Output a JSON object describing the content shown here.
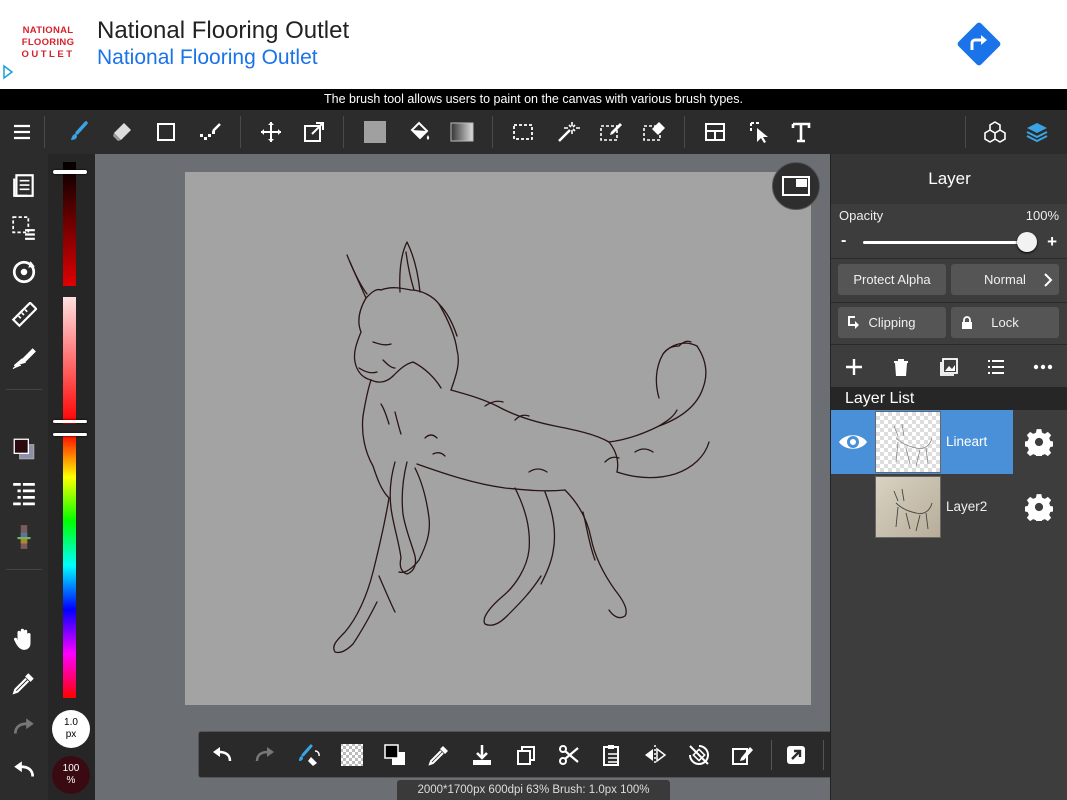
{
  "ad": {
    "logo_line1": "NATIONAL",
    "logo_line2": "FLOORING",
    "logo_line3": "OUTLET",
    "title": "National Flooring Outlet",
    "subtitle": "National Flooring Outlet",
    "icons": [
      "adchoices-icon",
      "directions-icon"
    ]
  },
  "tip": "The brush tool allows users to paint on the canvas with various brush types.",
  "toolbar": {
    "active_tool": "brush",
    "accent_color": "#3aa3e3",
    "icons": [
      "menu-icon",
      "brush-icon",
      "eraser-icon",
      "rectangle-icon",
      "dot-brush-icon",
      "move-icon",
      "transform-icon",
      "fill-color-icon",
      "bucket-icon",
      "gradient-icon",
      "select-rect-icon",
      "magic-wand-icon",
      "select-pen-icon",
      "select-eraser-icon",
      "panel-icon",
      "operation-icon",
      "text-icon",
      "material-icon",
      "layer-icon"
    ]
  },
  "lefttools": {
    "icons": [
      "pages-icon",
      "selection-layer-icon",
      "rotate-icon",
      "ruler-icon",
      "fill-tool-icon",
      "color-swatch-icon",
      "layer-list-icon",
      "palette-icon",
      "hand-icon",
      "eyedropper-icon",
      "redo-icon",
      "undo-icon"
    ]
  },
  "colors": {
    "foreground": "#2b0a10",
    "background": "#8c90a8",
    "brush_size": "1.0",
    "brush_unit": "px",
    "opacity_value": "100",
    "opacity_unit": "%"
  },
  "canvas": {
    "paper_color": "#a3a3a3",
    "stroke_color": "#2a1416"
  },
  "bottombar": {
    "icons": [
      "undo-icon",
      "redo-icon",
      "brush-eraser-toggle-icon",
      "transparent-swatch-icon",
      "color-swap-icon",
      "eyedropper-icon",
      "save-icon",
      "copy-icon",
      "cut-icon",
      "paste-icon",
      "flip-icon",
      "rotate-reset-icon",
      "transform-icon",
      "share-icon",
      "more-icon"
    ]
  },
  "status": "2000*1700px 600dpi 63% Brush: 1.0px 100%",
  "panel": {
    "title": "Layer",
    "opacity_label": "Opacity",
    "opacity_value": "100%",
    "opacity_level": 1.0,
    "minus": "-",
    "plus": "+",
    "protect_alpha": "Protect Alpha",
    "blend_mode": "Normal",
    "clipping": "Clipping",
    "lock": "Lock",
    "action_icons": [
      "add-layer-icon",
      "delete-layer-icon",
      "layer-image-icon",
      "layer-list-icon",
      "more-icon"
    ],
    "list_label": "Layer List",
    "layers": [
      {
        "name": "Lineart",
        "selected": true,
        "visible": true
      },
      {
        "name": "Layer2",
        "selected": false,
        "visible": false
      }
    ],
    "selected_color": "#4a90d9"
  }
}
